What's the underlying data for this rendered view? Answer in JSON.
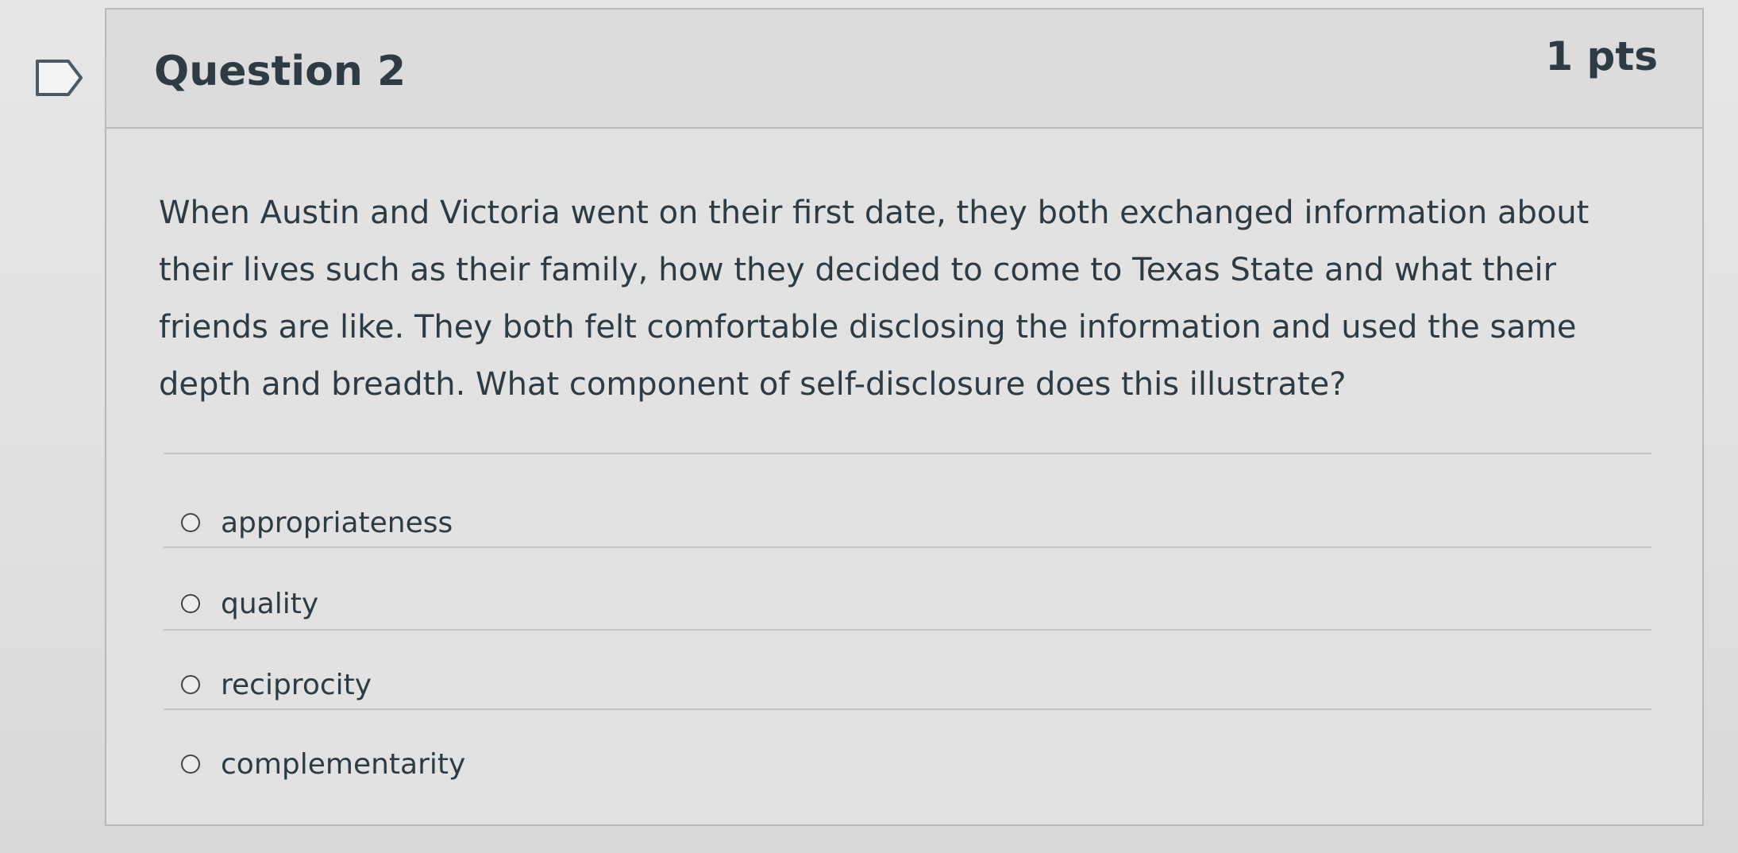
{
  "question": {
    "title": "Question 2",
    "points": "1 pts",
    "text": "When Austin and Victoria went on their first date, they both exchanged information about their lives such as their family, how they decided to come to Texas State and what their friends are like. They both felt comfortable disclosing the information and used the same depth and breadth. What component of self-disclosure does this illustrate?",
    "flag_icon": "flag-question-icon"
  },
  "answers": [
    {
      "label": "appropriateness",
      "selected": false
    },
    {
      "label": "quality",
      "selected": false
    },
    {
      "label": "reciprocity",
      "selected": false
    },
    {
      "label": "complementarity",
      "selected": false
    }
  ]
}
